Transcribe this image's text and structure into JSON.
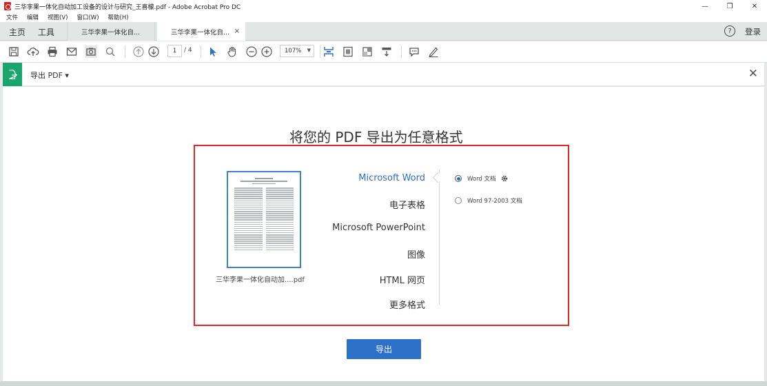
{
  "window": {
    "title": "三华李果一体化自动加工设备的设计与研究_王喜檬.pdf - Adobe Acrobat Pro DC",
    "minimize": "—",
    "restore": "❐",
    "close": "✕"
  },
  "menu": {
    "items": [
      "文件",
      "编辑",
      "视图(V)",
      "窗口(W)",
      "帮助(H)"
    ]
  },
  "tabs": {
    "home": "主页",
    "tools": "工具",
    "docs": [
      {
        "label": "三华李果一体化自...",
        "active": false
      },
      {
        "label": "三华李果一体化自...",
        "active": true
      }
    ],
    "close_glyph": "×",
    "help_glyph": "?",
    "login": "登录"
  },
  "toolbar": {
    "current_page": "1",
    "total_pages": "/ 4",
    "zoom": "107%",
    "zoom_arrow": "▼"
  },
  "panel": {
    "title": "导出 PDF ▾",
    "close_glyph": "✕"
  },
  "main": {
    "heading": "将您的 PDF 导出为任意格式",
    "file_name": "三华李果一体化自动加....pdf",
    "formats": [
      {
        "label": "Microsoft Word",
        "selected": true
      },
      {
        "label": "电子表格",
        "selected": false
      },
      {
        "label": "Microsoft PowerPoint",
        "selected": false
      },
      {
        "label": "图像",
        "selected": false
      },
      {
        "label": "HTML 网页",
        "selected": false
      },
      {
        "label": "更多格式",
        "selected": false
      }
    ],
    "options": [
      {
        "label": "Word 文档",
        "checked": true
      },
      {
        "label": "Word 97-2003 文档",
        "checked": false
      }
    ],
    "export_button": "导出"
  },
  "colors": {
    "accent_blue": "#2d70c8",
    "export_green": "#1aa56f",
    "highlight_red": "#e0262b"
  }
}
